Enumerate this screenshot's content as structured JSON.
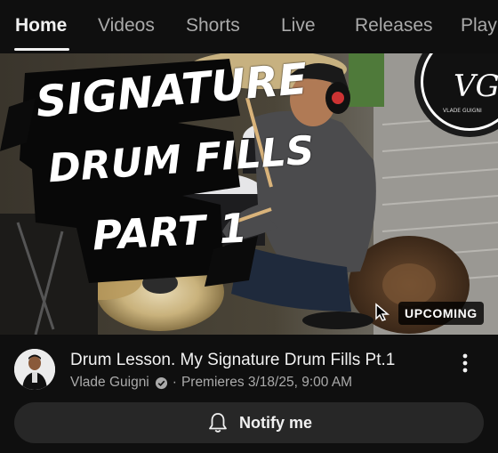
{
  "tabs": [
    {
      "label": "Home",
      "active": true
    },
    {
      "label": "Videos"
    },
    {
      "label": "Shorts"
    },
    {
      "label": "Live"
    },
    {
      "label": "Releases"
    },
    {
      "label": "Play"
    }
  ],
  "thumbnail": {
    "overlay_title": [
      "SIGNATURE",
      "DRUM FILLS",
      "PART 1"
    ],
    "badge": "UPCOMING",
    "logo_text": "VG",
    "logo_subtext": "VLADE GUIGNI"
  },
  "video": {
    "title": "Drum Lesson. My Signature Drum Fills Pt.1",
    "channel": "Vlade Guigni",
    "separator": "·",
    "premiere": "Premieres 3/18/25, 9:00 AM"
  },
  "notify_label": "Notify me",
  "icons": {
    "verified": "verified-check-icon",
    "more": "more-vertical-icon",
    "bell": "bell-icon"
  },
  "colors": {
    "background": "#0f0f0f",
    "text_primary": "#f1f1f1",
    "text_secondary": "#aaaaaa",
    "button_bg": "#272727"
  }
}
